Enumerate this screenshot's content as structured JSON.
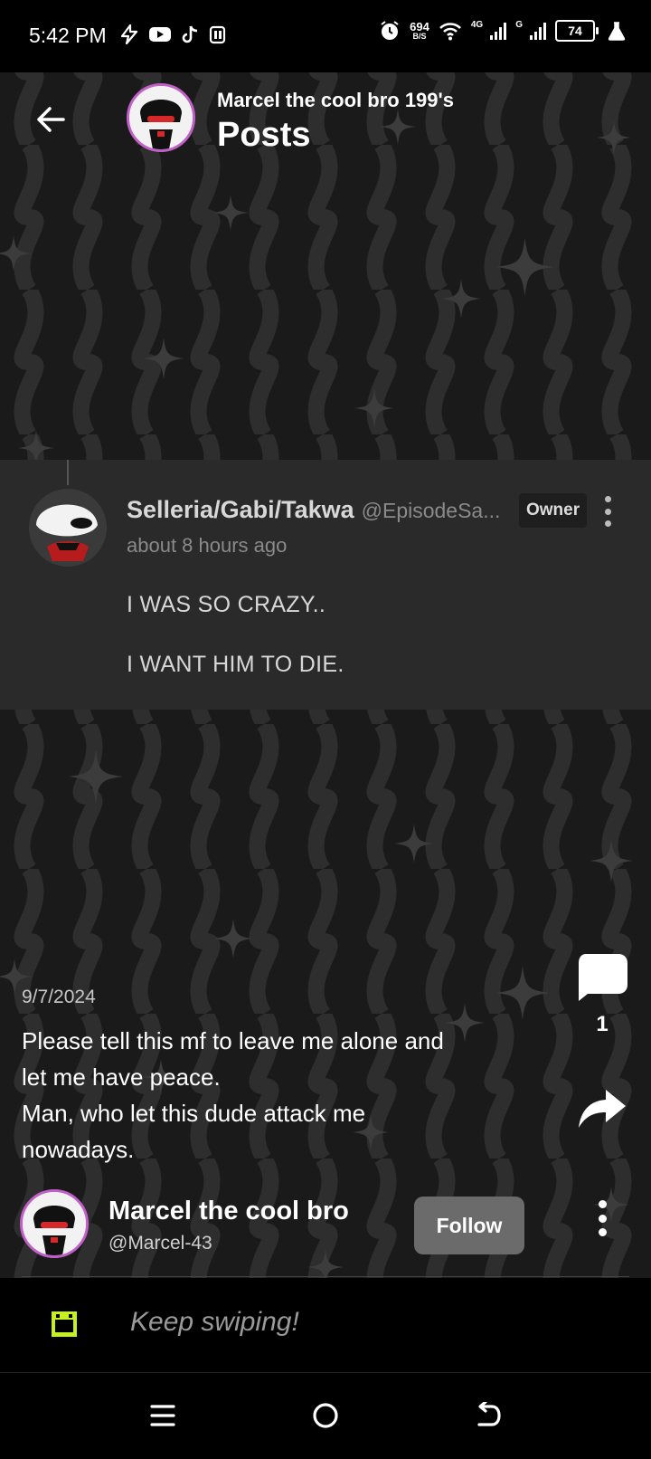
{
  "status_bar": {
    "time": "5:42 PM",
    "net_speed": "694",
    "net_unit": "B/S",
    "net_type_1": "4G",
    "net_type_2": "G",
    "battery": "74"
  },
  "header": {
    "subtitle": "Marcel the cool bro 199's",
    "title": "Posts"
  },
  "comment": {
    "author_name": "Selleria/Gabi/Takwa",
    "author_handle": "@EpisodeSa...",
    "badge": "Owner",
    "time": "about 8 hours ago",
    "line1": "I WAS SO CRAZY..",
    "line2": "I WANT HIM TO DIE."
  },
  "post": {
    "date": "9/7/2024",
    "text": "Please tell this mf to leave me alone and\nlet me have peace.\nMan, who let this dude attack me\nnowadays.",
    "comment_count": "1"
  },
  "author": {
    "name": "Marcel the cool bro",
    "handle": "@Marcel-43",
    "follow_label": "Follow"
  },
  "footer": {
    "swipe_text": "Keep swiping!"
  },
  "colors": {
    "background": "#1a1a1a",
    "card": "#2a2a2a",
    "follow_button": "#6b6b6b",
    "accent_green": "#c6f01e",
    "avatar_ring": "#c060c8"
  },
  "icons": {
    "back": "arrow-left-icon",
    "comment": "speech-bubble-icon",
    "share": "share-arrow-icon",
    "more": "vertical-dots-icon",
    "swipe": "green-face-icon",
    "nav_menu": "menu-icon",
    "nav_home": "home-circle-icon",
    "nav_back": "back-icon"
  }
}
